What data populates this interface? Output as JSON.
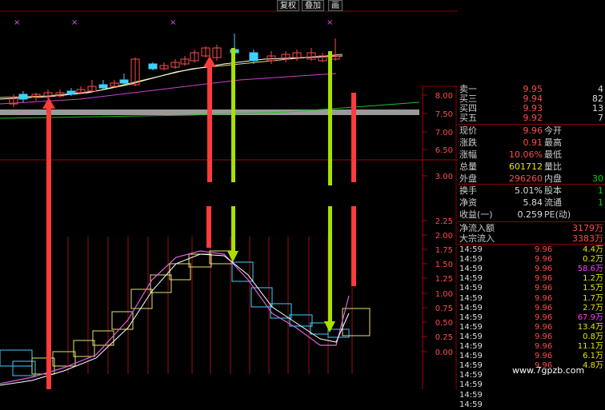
{
  "toolbar": {
    "restore_rights": "复权",
    "overlay": "叠加",
    "draw": "画"
  },
  "axis_upper": {
    "ticks": [
      "8.00",
      "7.50",
      "7.00",
      "6.50",
      "3.00"
    ]
  },
  "axis_lower": {
    "ticks": [
      "2.25",
      "2.00",
      "1.75",
      "1.50",
      "1.25",
      "1.00",
      "0.75",
      "0.50",
      "0.25",
      "0.00"
    ]
  },
  "quote_panel": {
    "order_book": [
      {
        "label": "卖一",
        "price": "9.95",
        "vol": "4"
      },
      {
        "label": "买三",
        "price": "9.94",
        "vol": "82"
      },
      {
        "label": "买四",
        "price": "9.93",
        "vol": "13"
      },
      {
        "label": "买五",
        "price": "9.92",
        "vol": "7"
      }
    ],
    "stats": [
      {
        "l1": "现价",
        "v1": "9.96",
        "c1": "red",
        "l2": "今开",
        "v2": ""
      },
      {
        "l1": "涨跌",
        "v1": "0.91",
        "c1": "red",
        "l2": "最高",
        "v2": ""
      },
      {
        "l1": "涨幅",
        "v1": "10.06%",
        "c1": "red",
        "l2": "最低",
        "v2": ""
      },
      {
        "l1": "总量",
        "v1": "601712",
        "c1": "yellow",
        "l2": "量比",
        "v2": ""
      },
      {
        "l1": "外盘",
        "v1": "296260",
        "c1": "red",
        "l2": "内盘",
        "v2": "30"
      },
      {
        "l1": "换手",
        "v1": "5.01%",
        "c1": "white",
        "l2": "股本",
        "v2": "1"
      },
      {
        "l1": "净资",
        "v1": "5.84",
        "c1": "white",
        "l2": "流通",
        "v2": "1"
      },
      {
        "l1": "收益(一)",
        "v1": "0.259",
        "c1": "white",
        "l2": "PE(动)",
        "v2": ""
      }
    ],
    "flows": [
      {
        "label": "净流入额",
        "value": "3179万"
      },
      {
        "label": "大宗流入",
        "value": "3383万"
      }
    ],
    "ticks": [
      {
        "time": "14:59",
        "price": "9.96",
        "vol": "4.4万",
        "color": "yellow"
      },
      {
        "time": "14:59",
        "price": "9.96",
        "vol": "0.2万",
        "color": "yellow"
      },
      {
        "time": "14:59",
        "price": "9.96",
        "vol": "58.6万",
        "color": "magenta"
      },
      {
        "time": "14:59",
        "price": "9.96",
        "vol": "1.2万",
        "color": "yellow"
      },
      {
        "time": "14:59",
        "price": "9.96",
        "vol": "1.5万",
        "color": "yellow"
      },
      {
        "time": "14:59",
        "price": "9.96",
        "vol": "1.7万",
        "color": "yellow"
      },
      {
        "time": "14:59",
        "price": "9.96",
        "vol": "2.7万",
        "color": "yellow"
      },
      {
        "time": "14:59",
        "price": "9.96",
        "vol": "67.9万",
        "color": "magenta"
      },
      {
        "time": "14:59",
        "price": "9.96",
        "vol": "13.4万",
        "color": "yellow"
      },
      {
        "time": "14:59",
        "price": "9.96",
        "vol": "0.8万",
        "color": "yellow"
      },
      {
        "time": "14:59",
        "price": "9.96",
        "vol": "11.1万",
        "color": "yellow"
      },
      {
        "time": "14:59",
        "price": "9.96",
        "vol": "6.1万",
        "color": "yellow"
      },
      {
        "time": "14:59",
        "price": "9.96",
        "vol": "4.8万",
        "color": "yellow"
      },
      {
        "time": "14:59",
        "price": "",
        "vol": "",
        "color": "yellow"
      },
      {
        "time": "14:59",
        "price": "",
        "vol": "",
        "color": "yellow"
      },
      {
        "time": "14:59",
        "price": "",
        "vol": "",
        "color": "yellow"
      },
      {
        "time": "14:59",
        "price": "",
        "vol": "",
        "color": "yellow"
      }
    ]
  },
  "watermark": "www.7gpzb.com",
  "colors": {
    "up": "#ff4b4b",
    "down": "#40d0ff",
    "arrow_red": "#ff3b3b",
    "arrow_green": "#a8e000",
    "axis_red": "#b00000"
  }
}
